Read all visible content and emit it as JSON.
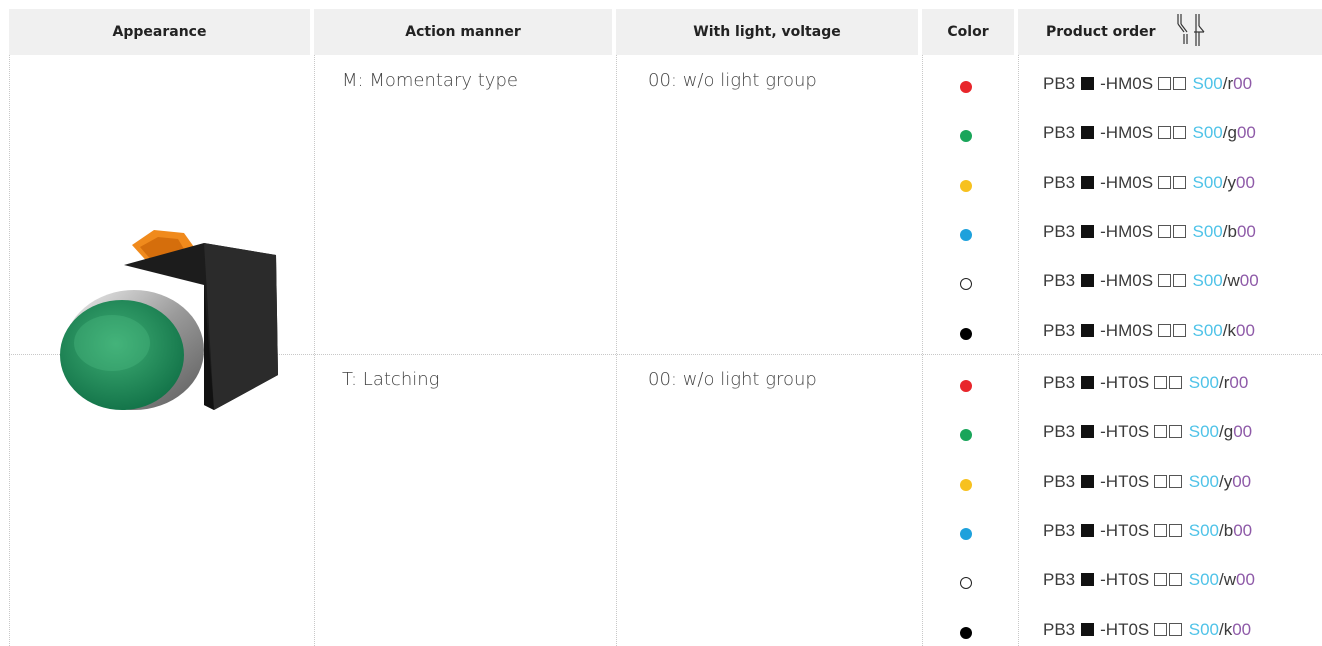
{
  "headers": {
    "appearance": "Appearance",
    "action": "Action manner",
    "light": "With light, voltage",
    "color": "Color",
    "order": "Product order"
  },
  "groups": [
    {
      "action": "M: Momentary type",
      "light": "00: w/o light group",
      "rows": [
        {
          "dot": "#e8262b",
          "outline": false,
          "prefix": "PB3",
          "mid": "-HM0S",
          "s": "S00",
          "slash": "/",
          "letter": "r",
          "tail": "00"
        },
        {
          "dot": "#19a55a",
          "outline": false,
          "prefix": "PB3",
          "mid": "-HM0S",
          "s": "S00",
          "slash": "/",
          "letter": "g",
          "tail": "00"
        },
        {
          "dot": "#f7c11f",
          "outline": false,
          "prefix": "PB3",
          "mid": "-HM0S",
          "s": "S00",
          "slash": "/",
          "letter": "y",
          "tail": "00"
        },
        {
          "dot": "#1ea1dc",
          "outline": false,
          "prefix": "PB3",
          "mid": "-HM0S",
          "s": "S00",
          "slash": "/",
          "letter": "b",
          "tail": "00"
        },
        {
          "dot": "#ffffff",
          "outline": true,
          "prefix": "PB3",
          "mid": "-HM0S",
          "s": "S00",
          "slash": "/",
          "letter": "w",
          "tail": "00"
        },
        {
          "dot": "#000000",
          "outline": false,
          "prefix": "PB3",
          "mid": "-HM0S",
          "s": "S00",
          "slash": "/",
          "letter": "k",
          "tail": "00"
        }
      ]
    },
    {
      "action": "T: Latching",
      "light": "00: w/o light group",
      "rows": [
        {
          "dot": "#e8262b",
          "outline": false,
          "prefix": "PB3",
          "mid": "-HT0S",
          "s": "S00",
          "slash": "/",
          "letter": "r",
          "tail": "00"
        },
        {
          "dot": "#19a55a",
          "outline": false,
          "prefix": "PB3",
          "mid": "-HT0S",
          "s": "S00",
          "slash": "/",
          "letter": "g",
          "tail": "00"
        },
        {
          "dot": "#f7c11f",
          "outline": false,
          "prefix": "PB3",
          "mid": "-HT0S",
          "s": "S00",
          "slash": "/",
          "letter": "y",
          "tail": "00"
        },
        {
          "dot": "#1ea1dc",
          "outline": false,
          "prefix": "PB3",
          "mid": "-HT0S",
          "s": "S00",
          "slash": "/",
          "letter": "b",
          "tail": "00"
        },
        {
          "dot": "#ffffff",
          "outline": true,
          "prefix": "PB3",
          "mid": "-HT0S",
          "s": "S00",
          "slash": "/",
          "letter": "w",
          "tail": "00"
        },
        {
          "dot": "#000000",
          "outline": false,
          "prefix": "PB3",
          "mid": "-HT0S",
          "s": "S00",
          "slash": "/",
          "letter": "k",
          "tail": "00"
        }
      ]
    }
  ],
  "colors": {
    "header_bg": "#f0f0f0",
    "s_code": "#4fc3e8",
    "voltage": "#8e5aa8"
  },
  "icons": {
    "header_order_icon": "switch-contact-icon",
    "product": "push-button-image"
  }
}
